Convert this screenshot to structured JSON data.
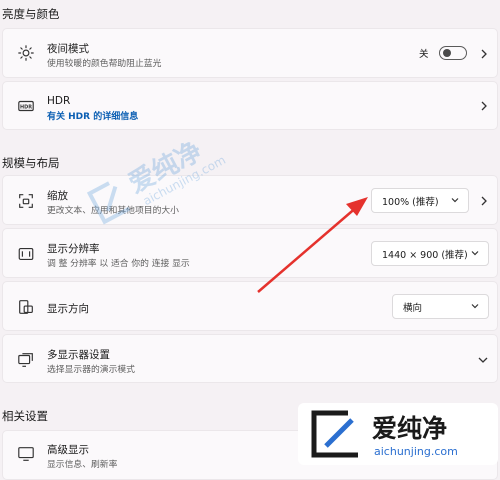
{
  "sections": {
    "brightness_color": "亮度与颜色",
    "scale_layout": "规模与布局",
    "related": "相关设置"
  },
  "night_light": {
    "title": "夜间模式",
    "subtitle": "使用较暖的颜色帮助阻止蓝光",
    "toggle_label": "关",
    "toggle_on": false
  },
  "hdr": {
    "title": "HDR",
    "link": "有关 HDR 的详细信息"
  },
  "scale": {
    "title": "缩放",
    "subtitle": "更改文本、应用和其他项目的大小",
    "value": "100% (推荐)"
  },
  "resolution": {
    "title": "显示分辨率",
    "subtitle": "调 整 分辨率 以 适合 你的 连接 显示",
    "value": "1440 × 900 (推荐)"
  },
  "orientation": {
    "title": "显示方向",
    "value": "横向"
  },
  "multi_display": {
    "title": "多显示器设置",
    "subtitle": "选择显示器的演示模式"
  },
  "advanced": {
    "title": "高级显示",
    "subtitle": "显示信息、刷新率"
  },
  "watermark": {
    "text_cn": "爱纯净",
    "text_en": "aichunjing.com"
  },
  "colors": {
    "accent_link": "#0b5fb3",
    "arrow": "#e5322d"
  }
}
